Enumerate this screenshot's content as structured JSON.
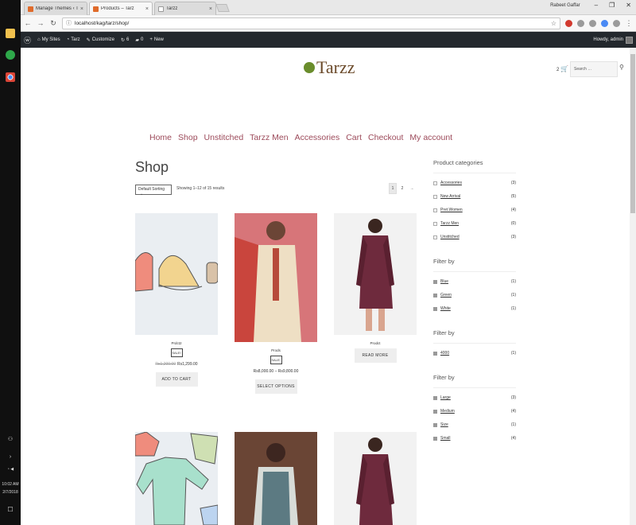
{
  "taskbar": {
    "time": "10:02 AM",
    "date": "2/7/2018"
  },
  "browser": {
    "tabs": [
      {
        "label": "Manage Themes ‹ Tarz ·",
        "active": false,
        "favicon_color": "#e06b2b"
      },
      {
        "label": "Products – Tarz",
        "active": true,
        "favicon_color": "#e06b2b"
      },
      {
        "label": "Tarzz",
        "active": false,
        "favicon_color": "#ffffff"
      }
    ],
    "window_user": "Rabeet Gaffar",
    "url": "localhost/kag/tarz/shop/"
  },
  "admin_bar": {
    "my_sites": "My Sites",
    "site_name": "Tarz",
    "customize": "Customize",
    "updates_count": "6",
    "comments_count": "0",
    "new_label": "New",
    "howdy": "Howdy, admin"
  },
  "header": {
    "logo_text": "Tarzz",
    "cart_count": "2",
    "search_placeholder": "Search …"
  },
  "nav": {
    "items": [
      "Home",
      "Shop",
      "Unstitched",
      "Tarzz Men",
      "Accessories",
      "Cart",
      "Checkout",
      "My account"
    ]
  },
  "shop": {
    "title": "Shop",
    "sort_label": "Default Sorting",
    "result_count": "Showing 1–12 of 15 results",
    "pages": [
      "1",
      "2",
      "→"
    ]
  },
  "products": [
    {
      "name": "Prdct2",
      "sale": "SALE!",
      "old_price": "Rs1,200.00",
      "price": "Rs1,299.00",
      "button": "ADD TO CART"
    },
    {
      "name": "Prods",
      "sale": "SALE!",
      "old_price": "",
      "price": "Rs8,000.00 – Rs9,800.00",
      "button": "SELECT OPTIONS"
    },
    {
      "name": "Prodct",
      "sale": "",
      "old_price": "",
      "price": "",
      "button": "READ MORE"
    },
    {
      "name": "",
      "sale": "",
      "old_price": "",
      "price": "",
      "button": ""
    },
    {
      "name": "",
      "sale": "",
      "old_price": "",
      "price": "",
      "button": ""
    },
    {
      "name": "",
      "sale": "",
      "old_price": "",
      "price": "",
      "button": ""
    }
  ],
  "sidebar": {
    "categories_title": "Product categories",
    "categories": [
      {
        "label": "Accessories",
        "count": "(3)"
      },
      {
        "label": "New Arrival",
        "count": "(5)"
      },
      {
        "label": "Pret Women",
        "count": "(4)"
      },
      {
        "label": "Tarzz Men",
        "count": "(0)"
      },
      {
        "label": "Unstitched",
        "count": "(3)"
      }
    ],
    "filter1_title": "Filter by",
    "filter1": [
      {
        "label": "Blue",
        "count": "(1)"
      },
      {
        "label": "Green",
        "count": "(1)"
      },
      {
        "label": "White",
        "count": "(1)"
      }
    ],
    "filter2_title": "Filter by",
    "filter2": [
      {
        "label": "4000",
        "count": "(1)"
      }
    ],
    "filter3_title": "Filter by",
    "filter3": [
      {
        "label": "Large",
        "count": "(3)"
      },
      {
        "label": "Medium",
        "count": "(4)"
      },
      {
        "label": "Size",
        "count": "(1)"
      },
      {
        "label": "Small",
        "count": "(4)"
      }
    ]
  }
}
